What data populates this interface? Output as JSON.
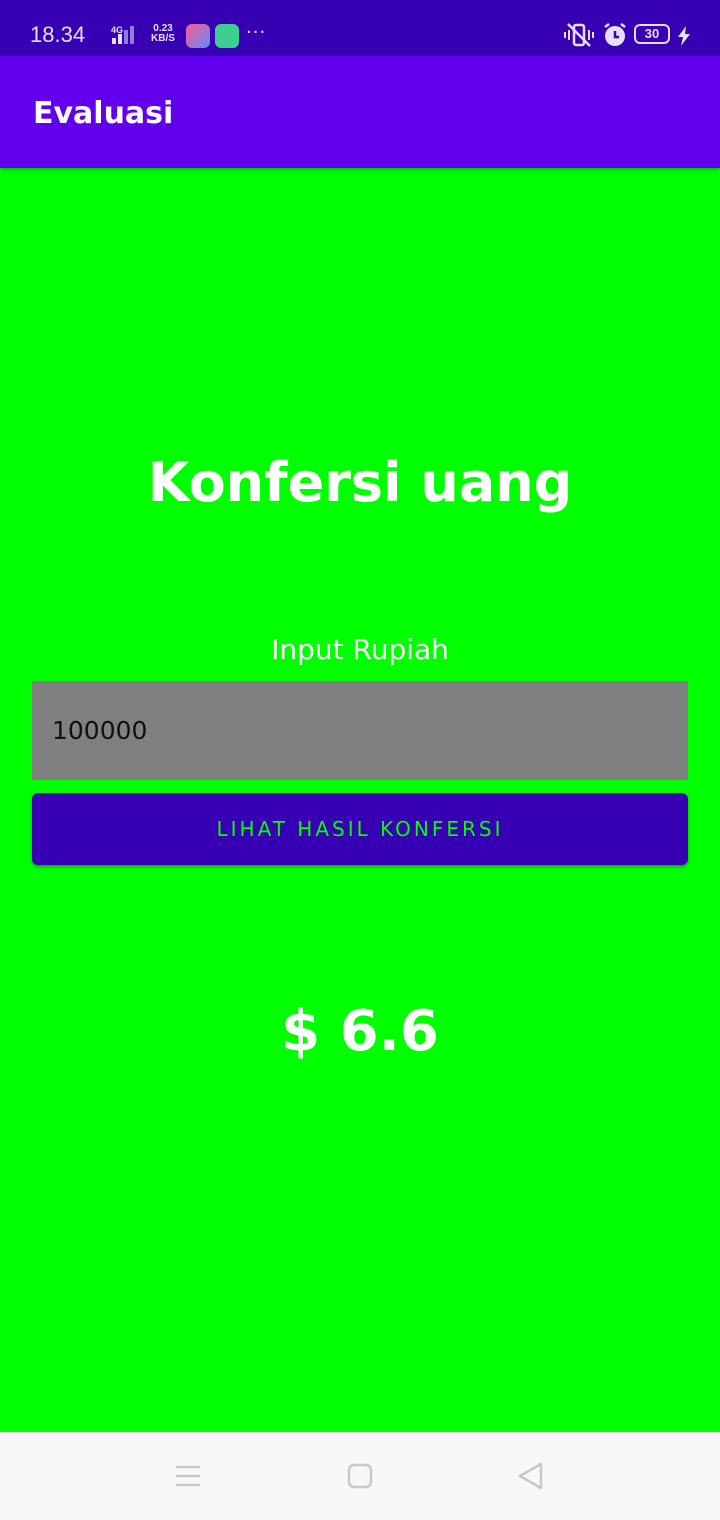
{
  "status_bar": {
    "time": "18.34",
    "network": "4G",
    "speed_value": "0.23",
    "speed_unit": "KB/S",
    "more": "···",
    "battery": "30"
  },
  "app_bar": {
    "title": "Evaluasi"
  },
  "main": {
    "heading": "Konfersi uang",
    "input_label": "Input Rupiah",
    "input_value": "100000",
    "button_label": "LIHAT HASIL KONFERSI",
    "result": "$ 6.6"
  },
  "colors": {
    "status_bar": "#3700b3",
    "app_bar": "#6200ee",
    "background": "#00ff00",
    "input_bg": "#808080",
    "button_bg": "#3700b3",
    "button_text": "#00ff00"
  },
  "nav_bar": {
    "icons": [
      "menu-icon",
      "home-icon",
      "back-icon"
    ]
  }
}
